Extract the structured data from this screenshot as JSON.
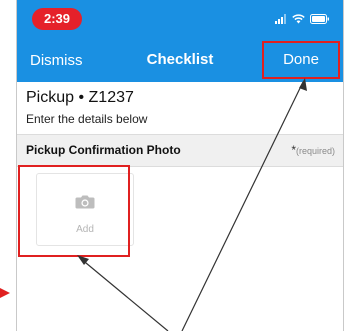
{
  "status_bar": {
    "time": "2:39"
  },
  "nav": {
    "dismiss_label": "Dismiss",
    "title": "Checklist",
    "done_label": "Done"
  },
  "header": {
    "title": "Pickup  • Z1237",
    "subtitle": "Enter the details below"
  },
  "section": {
    "label": "Pickup Confirmation Photo",
    "required_star": "*",
    "required_text": "(required)"
  },
  "photo": {
    "add_label": "Add",
    "icon": "camera-icon"
  },
  "colors": {
    "nav_blue": "#1a90e2",
    "time_pill": "#e5212a",
    "highlight_red": "#e02020"
  }
}
